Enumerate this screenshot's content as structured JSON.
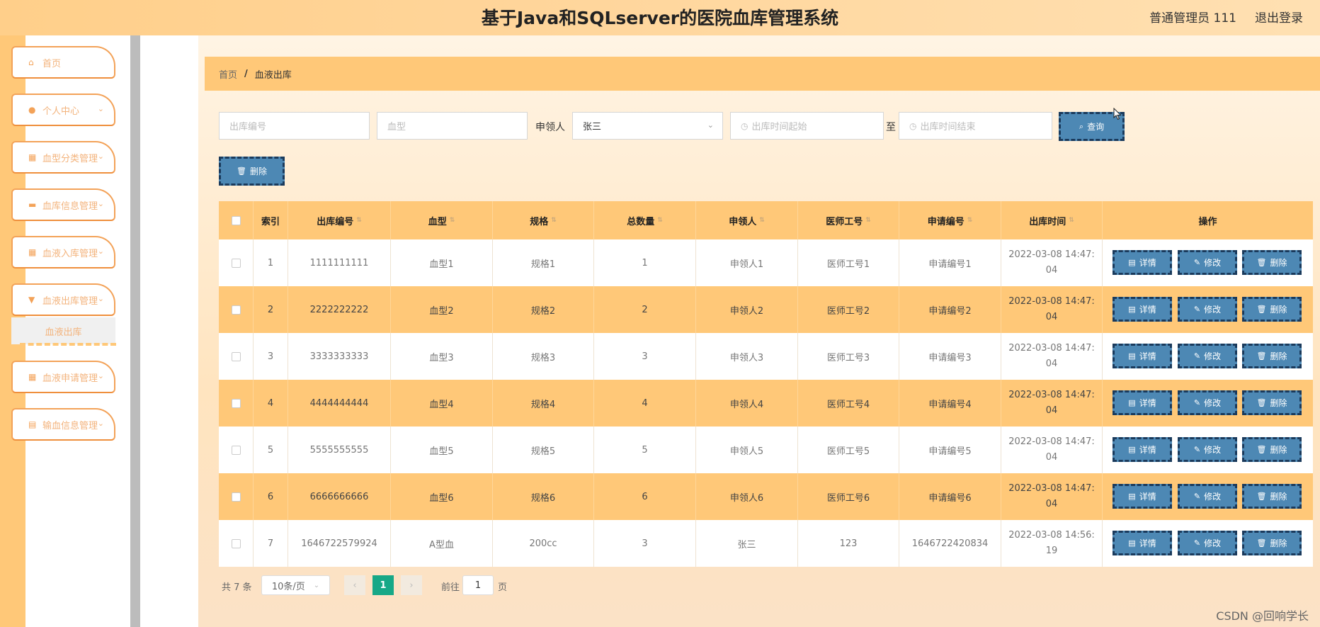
{
  "header": {
    "title": "基于Java和SQLserver的医院血库管理系统",
    "user": "普通管理员 111",
    "logout": "退出登录"
  },
  "sidebar": {
    "items": [
      {
        "label": "首页",
        "icon": "home-icon"
      },
      {
        "label": "个人中心",
        "icon": "user-icon"
      },
      {
        "label": "血型分类管理",
        "icon": "grid-icon"
      },
      {
        "label": "血库信息管理",
        "icon": "briefcase-icon"
      },
      {
        "label": "血液入库管理",
        "icon": "grid-icon"
      },
      {
        "label": "血液出库管理",
        "icon": "cup-icon"
      },
      {
        "label": "血液申请管理",
        "icon": "grid-icon"
      },
      {
        "label": "输血信息管理",
        "icon": "clipboard-icon"
      }
    ],
    "submenu": "血液出库"
  },
  "breadcrumb": {
    "home": "首页",
    "sep": "/",
    "current": "血液出库"
  },
  "search": {
    "outbound_no_placeholder": "出库编号",
    "blood_type_placeholder": "血型",
    "applicant_label": "申领人",
    "applicant_value": "张三",
    "time_start_placeholder": "出库时间起始",
    "to_label": "至",
    "time_end_placeholder": "出库时间结束",
    "query_label": "查询"
  },
  "toolbar": {
    "delete_label": "删除"
  },
  "table": {
    "headers": [
      "索引",
      "出库编号",
      "血型",
      "规格",
      "总数量",
      "申领人",
      "医师工号",
      "申请编号",
      "出库时间",
      "操作"
    ],
    "rows": [
      {
        "idx": "1",
        "no": "1111111111",
        "type": "血型1",
        "spec": "规格1",
        "qty": "1",
        "applicant": "申领人1",
        "doc": "医师工号1",
        "apply": "申请编号1",
        "time1": "2022-03-08 14:47:",
        "time2": "04"
      },
      {
        "idx": "2",
        "no": "2222222222",
        "type": "血型2",
        "spec": "规格2",
        "qty": "2",
        "applicant": "申领人2",
        "doc": "医师工号2",
        "apply": "申请编号2",
        "time1": "2022-03-08 14:47:",
        "time2": "04"
      },
      {
        "idx": "3",
        "no": "3333333333",
        "type": "血型3",
        "spec": "规格3",
        "qty": "3",
        "applicant": "申领人3",
        "doc": "医师工号3",
        "apply": "申请编号3",
        "time1": "2022-03-08 14:47:",
        "time2": "04"
      },
      {
        "idx": "4",
        "no": "4444444444",
        "type": "血型4",
        "spec": "规格4",
        "qty": "4",
        "applicant": "申领人4",
        "doc": "医师工号4",
        "apply": "申请编号4",
        "time1": "2022-03-08 14:47:",
        "time2": "04"
      },
      {
        "idx": "5",
        "no": "5555555555",
        "type": "血型5",
        "spec": "规格5",
        "qty": "5",
        "applicant": "申领人5",
        "doc": "医师工号5",
        "apply": "申请编号5",
        "time1": "2022-03-08 14:47:",
        "time2": "04"
      },
      {
        "idx": "6",
        "no": "6666666666",
        "type": "血型6",
        "spec": "规格6",
        "qty": "6",
        "applicant": "申领人6",
        "doc": "医师工号6",
        "apply": "申请编号6",
        "time1": "2022-03-08 14:47:",
        "time2": "04"
      },
      {
        "idx": "7",
        "no": "1646722579924",
        "type": "A型血",
        "spec": "200cc",
        "qty": "3",
        "applicant": "张三",
        "doc": "123",
        "apply": "1646722420834",
        "time1": "2022-03-08 14:56:",
        "time2": "19"
      }
    ],
    "ops": {
      "detail": "详情",
      "edit": "修改",
      "delete": "删除"
    }
  },
  "pagination": {
    "total": "共 7 条",
    "page_size": "10条/页",
    "current_page": "1",
    "goto_label": "前往",
    "goto_value": "1",
    "page_suffix": "页"
  },
  "watermark": "CSDN @回响学长"
}
